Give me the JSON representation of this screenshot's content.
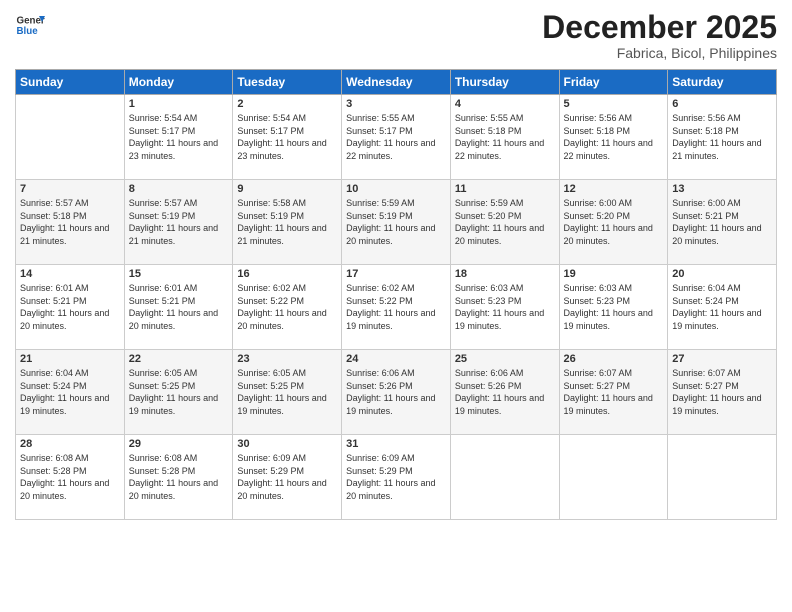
{
  "logo": {
    "line1": "General",
    "line2": "Blue"
  },
  "title": "December 2025",
  "subtitle": "Fabrica, Bicol, Philippines",
  "days_header": [
    "Sunday",
    "Monday",
    "Tuesday",
    "Wednesday",
    "Thursday",
    "Friday",
    "Saturday"
  ],
  "weeks": [
    [
      {
        "num": "",
        "sunrise": "",
        "sunset": "",
        "daylight": ""
      },
      {
        "num": "1",
        "sunrise": "Sunrise: 5:54 AM",
        "sunset": "Sunset: 5:17 PM",
        "daylight": "Daylight: 11 hours and 23 minutes."
      },
      {
        "num": "2",
        "sunrise": "Sunrise: 5:54 AM",
        "sunset": "Sunset: 5:17 PM",
        "daylight": "Daylight: 11 hours and 23 minutes."
      },
      {
        "num": "3",
        "sunrise": "Sunrise: 5:55 AM",
        "sunset": "Sunset: 5:17 PM",
        "daylight": "Daylight: 11 hours and 22 minutes."
      },
      {
        "num": "4",
        "sunrise": "Sunrise: 5:55 AM",
        "sunset": "Sunset: 5:18 PM",
        "daylight": "Daylight: 11 hours and 22 minutes."
      },
      {
        "num": "5",
        "sunrise": "Sunrise: 5:56 AM",
        "sunset": "Sunset: 5:18 PM",
        "daylight": "Daylight: 11 hours and 22 minutes."
      },
      {
        "num": "6",
        "sunrise": "Sunrise: 5:56 AM",
        "sunset": "Sunset: 5:18 PM",
        "daylight": "Daylight: 11 hours and 21 minutes."
      }
    ],
    [
      {
        "num": "7",
        "sunrise": "Sunrise: 5:57 AM",
        "sunset": "Sunset: 5:18 PM",
        "daylight": "Daylight: 11 hours and 21 minutes."
      },
      {
        "num": "8",
        "sunrise": "Sunrise: 5:57 AM",
        "sunset": "Sunset: 5:19 PM",
        "daylight": "Daylight: 11 hours and 21 minutes."
      },
      {
        "num": "9",
        "sunrise": "Sunrise: 5:58 AM",
        "sunset": "Sunset: 5:19 PM",
        "daylight": "Daylight: 11 hours and 21 minutes."
      },
      {
        "num": "10",
        "sunrise": "Sunrise: 5:59 AM",
        "sunset": "Sunset: 5:19 PM",
        "daylight": "Daylight: 11 hours and 20 minutes."
      },
      {
        "num": "11",
        "sunrise": "Sunrise: 5:59 AM",
        "sunset": "Sunset: 5:20 PM",
        "daylight": "Daylight: 11 hours and 20 minutes."
      },
      {
        "num": "12",
        "sunrise": "Sunrise: 6:00 AM",
        "sunset": "Sunset: 5:20 PM",
        "daylight": "Daylight: 11 hours and 20 minutes."
      },
      {
        "num": "13",
        "sunrise": "Sunrise: 6:00 AM",
        "sunset": "Sunset: 5:21 PM",
        "daylight": "Daylight: 11 hours and 20 minutes."
      }
    ],
    [
      {
        "num": "14",
        "sunrise": "Sunrise: 6:01 AM",
        "sunset": "Sunset: 5:21 PM",
        "daylight": "Daylight: 11 hours and 20 minutes."
      },
      {
        "num": "15",
        "sunrise": "Sunrise: 6:01 AM",
        "sunset": "Sunset: 5:21 PM",
        "daylight": "Daylight: 11 hours and 20 minutes."
      },
      {
        "num": "16",
        "sunrise": "Sunrise: 6:02 AM",
        "sunset": "Sunset: 5:22 PM",
        "daylight": "Daylight: 11 hours and 20 minutes."
      },
      {
        "num": "17",
        "sunrise": "Sunrise: 6:02 AM",
        "sunset": "Sunset: 5:22 PM",
        "daylight": "Daylight: 11 hours and 19 minutes."
      },
      {
        "num": "18",
        "sunrise": "Sunrise: 6:03 AM",
        "sunset": "Sunset: 5:23 PM",
        "daylight": "Daylight: 11 hours and 19 minutes."
      },
      {
        "num": "19",
        "sunrise": "Sunrise: 6:03 AM",
        "sunset": "Sunset: 5:23 PM",
        "daylight": "Daylight: 11 hours and 19 minutes."
      },
      {
        "num": "20",
        "sunrise": "Sunrise: 6:04 AM",
        "sunset": "Sunset: 5:24 PM",
        "daylight": "Daylight: 11 hours and 19 minutes."
      }
    ],
    [
      {
        "num": "21",
        "sunrise": "Sunrise: 6:04 AM",
        "sunset": "Sunset: 5:24 PM",
        "daylight": "Daylight: 11 hours and 19 minutes."
      },
      {
        "num": "22",
        "sunrise": "Sunrise: 6:05 AM",
        "sunset": "Sunset: 5:25 PM",
        "daylight": "Daylight: 11 hours and 19 minutes."
      },
      {
        "num": "23",
        "sunrise": "Sunrise: 6:05 AM",
        "sunset": "Sunset: 5:25 PM",
        "daylight": "Daylight: 11 hours and 19 minutes."
      },
      {
        "num": "24",
        "sunrise": "Sunrise: 6:06 AM",
        "sunset": "Sunset: 5:26 PM",
        "daylight": "Daylight: 11 hours and 19 minutes."
      },
      {
        "num": "25",
        "sunrise": "Sunrise: 6:06 AM",
        "sunset": "Sunset: 5:26 PM",
        "daylight": "Daylight: 11 hours and 19 minutes."
      },
      {
        "num": "26",
        "sunrise": "Sunrise: 6:07 AM",
        "sunset": "Sunset: 5:27 PM",
        "daylight": "Daylight: 11 hours and 19 minutes."
      },
      {
        "num": "27",
        "sunrise": "Sunrise: 6:07 AM",
        "sunset": "Sunset: 5:27 PM",
        "daylight": "Daylight: 11 hours and 19 minutes."
      }
    ],
    [
      {
        "num": "28",
        "sunrise": "Sunrise: 6:08 AM",
        "sunset": "Sunset: 5:28 PM",
        "daylight": "Daylight: 11 hours and 20 minutes."
      },
      {
        "num": "29",
        "sunrise": "Sunrise: 6:08 AM",
        "sunset": "Sunset: 5:28 PM",
        "daylight": "Daylight: 11 hours and 20 minutes."
      },
      {
        "num": "30",
        "sunrise": "Sunrise: 6:09 AM",
        "sunset": "Sunset: 5:29 PM",
        "daylight": "Daylight: 11 hours and 20 minutes."
      },
      {
        "num": "31",
        "sunrise": "Sunrise: 6:09 AM",
        "sunset": "Sunset: 5:29 PM",
        "daylight": "Daylight: 11 hours and 20 minutes."
      },
      {
        "num": "",
        "sunrise": "",
        "sunset": "",
        "daylight": ""
      },
      {
        "num": "",
        "sunrise": "",
        "sunset": "",
        "daylight": ""
      },
      {
        "num": "",
        "sunrise": "",
        "sunset": "",
        "daylight": ""
      }
    ]
  ]
}
